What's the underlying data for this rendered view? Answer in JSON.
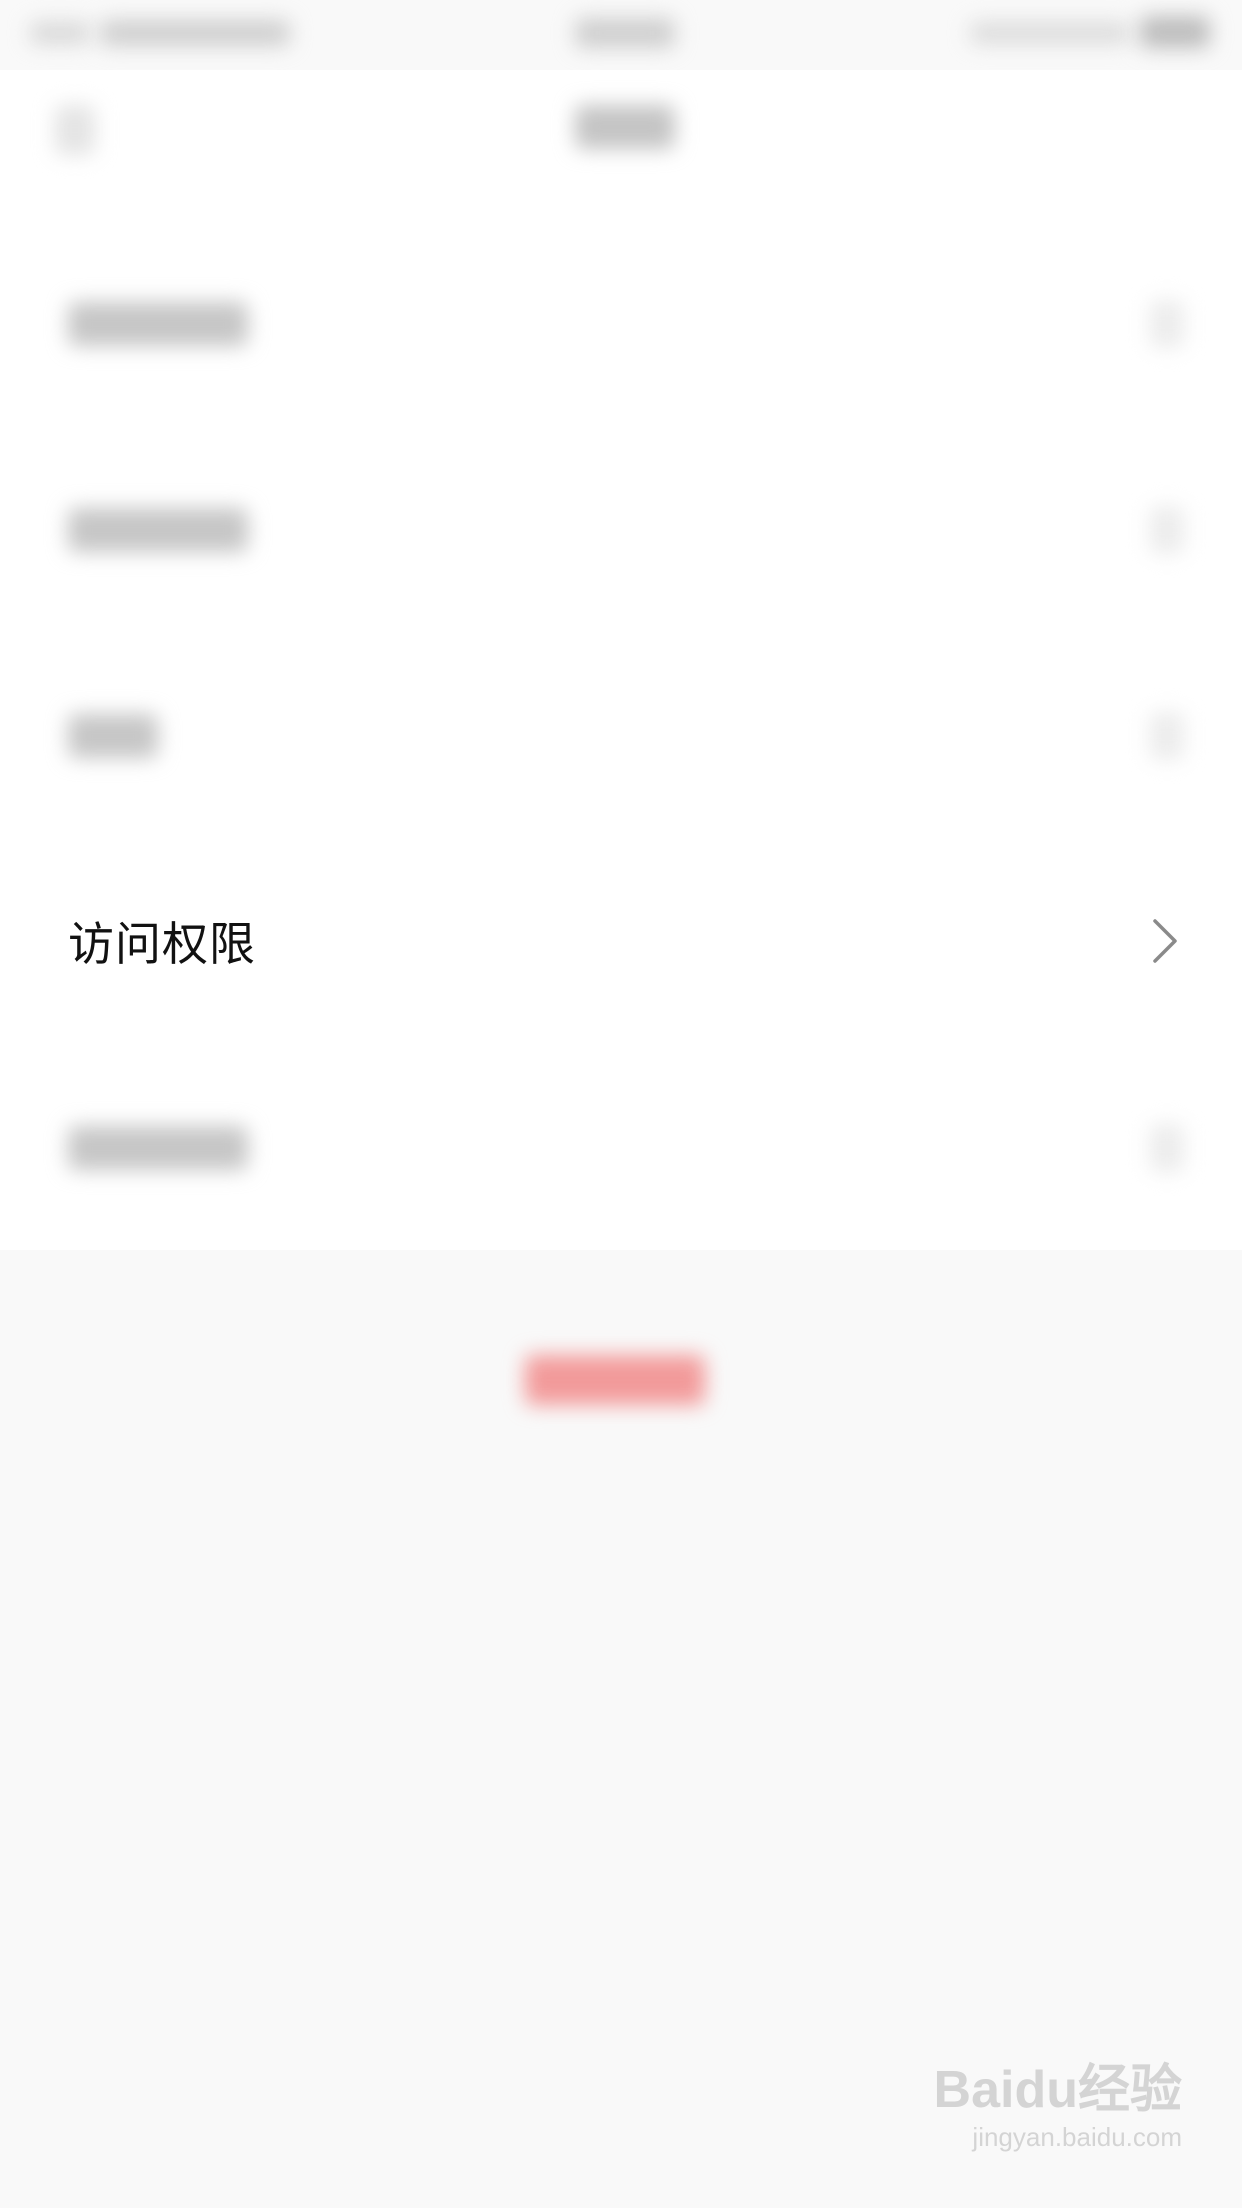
{
  "colors": {
    "background": "#f9f9f9",
    "list_background": "#ffffff",
    "text": "#111111",
    "blurred_text": "#c8c8c8",
    "destructive_accent": "#f08a8a",
    "chevron": "#8a8a8a",
    "watermark": "#d4d4d4"
  },
  "status_bar": {
    "left_icon": "signal-icon",
    "right_icon": "battery-icon"
  },
  "nav": {
    "back_icon": "back-chevron-icon"
  },
  "list": {
    "rows": [
      {
        "label": "",
        "blurred": true,
        "chevron_icon": "chevron-right-icon"
      },
      {
        "label": "",
        "blurred": true,
        "chevron_icon": "chevron-right-icon"
      },
      {
        "label": "",
        "blurred": true,
        "chevron_icon": "chevron-right-icon"
      },
      {
        "label": "访问权限",
        "blurred": false,
        "chevron_icon": "chevron-right-icon"
      },
      {
        "label": "",
        "blurred": true,
        "chevron_icon": "chevron-right-icon"
      }
    ]
  },
  "watermark": {
    "logo_icon": "baidu-jingyan-logo",
    "logo_text": "Baidu经验",
    "url": "jingyan.baidu.com"
  }
}
